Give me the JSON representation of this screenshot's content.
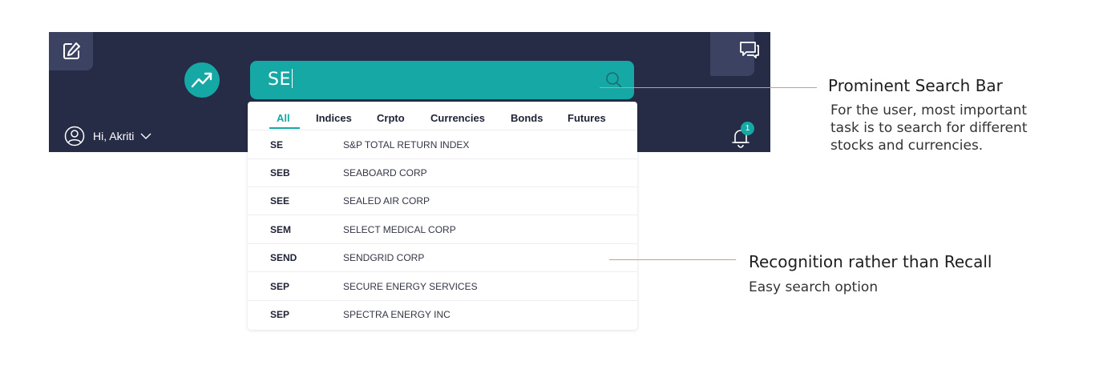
{
  "header": {
    "greeting": "Hi, Akriti",
    "notification_count": "1"
  },
  "search": {
    "value": "SE"
  },
  "tabs": [
    "All",
    "Indices",
    "Crpto",
    "Currencies",
    "Bonds",
    "Futures"
  ],
  "results": [
    {
      "symbol": "SE",
      "name": "S&P TOTAL RETURN INDEX"
    },
    {
      "symbol": "SEB",
      "name": "SEABOARD CORP"
    },
    {
      "symbol": "SEE",
      "name": "SEALED AIR CORP"
    },
    {
      "symbol": "SEM",
      "name": "SELECT MEDICAL CORP"
    },
    {
      "symbol": "SEND",
      "name": "SENDGRID CORP"
    },
    {
      "symbol": "SEP",
      "name": "SECURE ENERGY SERVICES"
    },
    {
      "symbol": "SEP",
      "name": "SPECTRA ENERGY INC"
    }
  ],
  "annotations": [
    {
      "title": "Prominent Search Bar",
      "desc_lines": [
        "For the user, most important",
        "task is to search for different",
        "stocks and currencies."
      ]
    },
    {
      "title": "Recognition rather than Recall",
      "desc_lines": [
        "Easy search option"
      ]
    }
  ],
  "colors": {
    "appbar": "#262c45",
    "accent": "#16a8a4",
    "button_bg": "#3b4262",
    "callout_line": "#c9a07c"
  },
  "icons": [
    "edit-icon",
    "trending-up-icon",
    "search-icon",
    "chat-icon",
    "user-icon",
    "chevron-down-icon",
    "bell-icon"
  ]
}
